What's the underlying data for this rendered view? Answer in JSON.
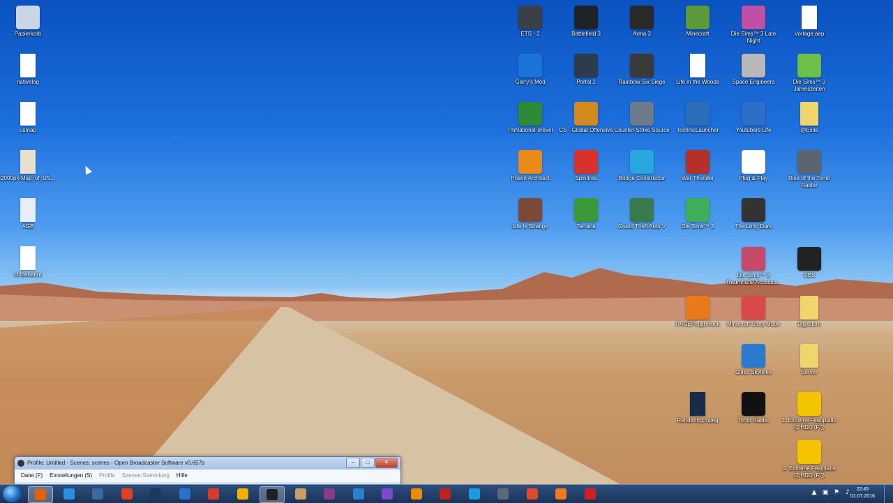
{
  "desktop_icons_left": [
    {
      "label": "Papierkorb",
      "icon": "recycle-bin-icon",
      "color": "#c8d6e6"
    },
    {
      "label": "nativelog",
      "icon": "text-file-icon",
      "color": "#ffffff"
    },
    {
      "label": "usmap",
      "icon": "image-file-icon",
      "color": "#ffffff"
    },
    {
      "label": "2000px-Map_of_US...",
      "icon": "image-file-icon",
      "color": "#e9dfcf"
    },
    {
      "label": "AGB",
      "icon": "document-icon",
      "color": "#e8eef5"
    },
    {
      "label": "Unbenannt",
      "icon": "document-icon",
      "color": "#ffffff"
    }
  ],
  "desktop_icons_right": [
    [
      {
        "label": "ETS - 2",
        "icon": "truck-game-icon",
        "color": "#3b3f46"
      },
      {
        "label": "Battlefield 3",
        "icon": "soldier-game-icon",
        "color": "#1f2226"
      },
      {
        "label": "Arma 3",
        "icon": "arma-game-icon",
        "color": "#2a2a2a"
      },
      {
        "label": "Minecraft",
        "icon": "minecraft-icon",
        "color": "#5d9b3a"
      },
      {
        "label": "Die Sims™ 3 Late Night",
        "icon": "sims-icon",
        "color": "#c24fa6"
      },
      {
        "label": "Vorlage.aep",
        "icon": "file-icon",
        "color": "#ffffff"
      }
    ],
    [
      {
        "label": "Garry's Mod",
        "icon": "garrys-mod-icon",
        "color": "#1a73d9"
      },
      {
        "label": "Portal 2",
        "icon": "portal-icon",
        "color": "#2c3c4e"
      },
      {
        "label": "Rainbow Six Siege",
        "icon": "rainbow-six-icon",
        "color": "#3a3a3a"
      },
      {
        "label": "Life in the Woods",
        "icon": "java-file-icon",
        "color": "#ffffff"
      },
      {
        "label": "Space Engineers",
        "icon": "astronaut-icon",
        "color": "#b8b8b8"
      },
      {
        "label": "Die Sims™ 3 Jahreszeiten",
        "icon": "sims-icon",
        "color": "#6cc04a"
      }
    ],
    [
      {
        "label": "TmNationsForever",
        "icon": "trackmania-icon",
        "color": "#2d8a36"
      },
      {
        "label": "CS - Global Offensive",
        "icon": "csgo-icon",
        "color": "#d38a1c"
      },
      {
        "label": "Counter-Strike Source",
        "icon": "css-icon",
        "color": "#6c7a8a"
      },
      {
        "label": "TechnicLauncher",
        "icon": "technic-icon",
        "color": "#2b6fb8"
      },
      {
        "label": "Youtubers Life",
        "icon": "youtubers-life-icon",
        "color": "#2d6fc8"
      },
      {
        "label": "@Exile",
        "icon": "folder-icon",
        "color": "#f0d66a"
      }
    ],
    [
      {
        "label": "Prison Architect",
        "icon": "prisoner-icon",
        "color": "#e88b1a"
      },
      {
        "label": "Spintires",
        "icon": "star-icon",
        "color": "#d8322a"
      },
      {
        "label": "Bridge Constructor",
        "icon": "bridge-icon",
        "color": "#27a7e0"
      },
      {
        "label": "War Thunder",
        "icon": "war-thunder-icon",
        "color": "#b5302b"
      },
      {
        "label": "Plug & Play",
        "icon": "plug-icon",
        "color": "#ffffff"
      },
      {
        "label": "Rise of the Tomb Raider",
        "icon": "tomb-raider-icon",
        "color": "#5a6570"
      }
    ],
    [
      {
        "label": "Life is Strange",
        "icon": "life-is-strange-icon",
        "color": "#7d4a3a"
      },
      {
        "label": "Terraria",
        "icon": "terraria-icon",
        "color": "#3a9a3a"
      },
      {
        "label": "Grand Theft Auto V",
        "icon": "gta-icon",
        "color": "#3b7a4c"
      },
      {
        "label": "Die Sims™ 3",
        "icon": "sims-icon",
        "color": "#3fae5a"
      },
      {
        "label": "The Long Dark",
        "icon": "axe-icon",
        "color": "#333333"
      },
      {
        "label": "",
        "icon": "",
        "color": ""
      }
    ]
  ],
  "desktop_icons_extra": [
    {
      "label": "Die Sims™ 3 Traumhafte Accesso...",
      "icon": "sims-icon",
      "color": "#c74a6a"
    },
    {
      "label": "OBS",
      "icon": "obs-icon",
      "color": "#222222"
    },
    {
      "label": "RAGEPluginHook",
      "icon": "rage-icon",
      "color": "#e87a1a"
    },
    {
      "label": "Minecraft Story Mode",
      "icon": "minecraft-story-icon",
      "color": "#d94a4a"
    },
    {
      "label": "Digitalunr",
      "icon": "folder-icon",
      "color": "#f0d66a"
    },
    {
      "label": "Cities Skylines",
      "icon": "cities-skylines-icon",
      "color": "#2a7ad0"
    },
    {
      "label": "Server",
      "icon": "folder-icon",
      "color": "#f0d66a"
    },
    {
      "label": "Rendering.mpeg",
      "icon": "video-file-icon",
      "color": "#1a2a4a"
    },
    {
      "label": "Tomb Raider",
      "icon": "tomb-raider-logo-icon",
      "color": "#111111"
    },
    {
      "label": "1. Extreme Feedplatte (2 HDD (F:))",
      "icon": "star-icon",
      "color": "#f5c400"
    },
    {
      "label": "2. Extreme Festplatte (2 HDD (F:))",
      "icon": "star-icon",
      "color": "#f5c400"
    }
  ],
  "obs_window": {
    "title": "Profile: Untitled - Scenes: scenes - Open Broadcaster Software v0.657b",
    "menu": [
      "Datei (F)",
      "Einstellungen (S)",
      "Profile",
      "Szenen-Sammlung",
      "Hilfe"
    ],
    "controls": {
      "minimize": "–",
      "maximize": "□",
      "close": "✕"
    }
  },
  "taskbar": {
    "apps": [
      {
        "name": "firefox",
        "color": "#e66000",
        "active": true
      },
      {
        "name": "utility",
        "color": "#2a8fe0",
        "active": false
      },
      {
        "name": "network",
        "color": "#3a6aa0",
        "active": false
      },
      {
        "name": "media-player",
        "color": "#e04020",
        "active": false
      },
      {
        "name": "steam",
        "color": "#1b3a5a",
        "active": false
      },
      {
        "name": "uplay",
        "color": "#2a70d0",
        "active": false
      },
      {
        "name": "chrome",
        "color": "#d93a2a",
        "active": false
      },
      {
        "name": "sims-launcher",
        "color": "#f0b000",
        "active": false
      },
      {
        "name": "obs",
        "color": "#222222",
        "active": true
      },
      {
        "name": "calendar",
        "color": "#c8a060",
        "active": false
      },
      {
        "name": "winrar",
        "color": "#8a3a8a",
        "active": false
      },
      {
        "name": "teamspeak",
        "color": "#2a80d0",
        "active": false
      },
      {
        "name": "after-effects",
        "color": "#7a4acb",
        "active": false
      },
      {
        "name": "vlc",
        "color": "#f08a00",
        "active": false
      },
      {
        "name": "audio",
        "color": "#c02020",
        "active": false
      },
      {
        "name": "skype",
        "color": "#1a9ae0",
        "active": false
      },
      {
        "name": "tool",
        "color": "#5a6a7a",
        "active": false
      },
      {
        "name": "origin",
        "color": "#e04a2a",
        "active": false
      },
      {
        "name": "app-orange",
        "color": "#f07a1a",
        "active": false
      },
      {
        "name": "app-red",
        "color": "#d02020",
        "active": false
      }
    ],
    "clock_time": "22:45",
    "clock_date": "01.07.2016"
  }
}
